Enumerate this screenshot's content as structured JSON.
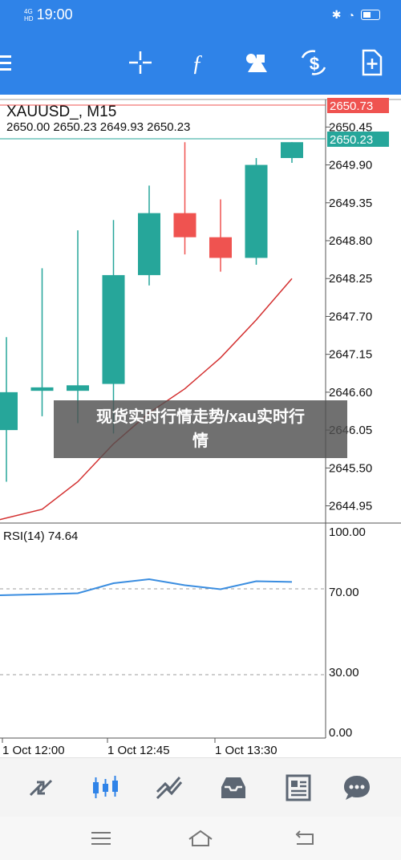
{
  "status_bar": {
    "network": "4G",
    "signal": "HD",
    "time": "19:00",
    "bluetooth_icon": "bluetooth-icon",
    "wifi_icon": "wifi-icon",
    "battery_icon": "battery-icon"
  },
  "toolbar": {
    "menu_icon": "menu-icon",
    "items": [
      {
        "name": "crosshair-icon"
      },
      {
        "name": "function-icon"
      },
      {
        "name": "objects-icon"
      },
      {
        "name": "currency-exchange-icon"
      },
      {
        "name": "new-order-icon"
      }
    ]
  },
  "chart": {
    "symbol_line": "XAUUSD_, M15",
    "ohlc_line": "2650.00 2650.23 2649.93 2650.23",
    "ask_label": "2650.73",
    "bid_label": "2650.23",
    "price_ticks": [
      "2650.45",
      "2649.90",
      "2649.35",
      "2648.80",
      "2648.25",
      "2647.70",
      "2647.15",
      "2646.60",
      "2646.05",
      "2645.50",
      "2644.95"
    ],
    "rsi_label": "RSI(14) 74.64",
    "rsi_ticks": [
      "100.00",
      "70.00",
      "30.00",
      "0.00"
    ],
    "time_labels": [
      "1 Oct 12:00",
      "1 Oct 12:45",
      "1 Oct 13:30"
    ],
    "colors": {
      "bull": "#26a69a",
      "bear": "#ef5350",
      "ma": "#d32f2f",
      "rsi": "#3a8de0",
      "ask_line": "#ef5350",
      "bid_line": "#26a69a"
    }
  },
  "chart_data": {
    "type": "candlestick",
    "symbol": "XAUUSD_",
    "timeframe": "M15",
    "ylim": [
      2644.7,
      2650.85
    ],
    "candles": [
      {
        "o": 2646.05,
        "h": 2647.4,
        "l": 2645.3,
        "c": 2646.6
      },
      {
        "o": 2646.62,
        "h": 2648.4,
        "l": 2646.25,
        "c": 2646.67
      },
      {
        "o": 2646.62,
        "h": 2648.95,
        "l": 2646.15,
        "c": 2646.7
      },
      {
        "o": 2646.72,
        "h": 2649.1,
        "l": 2646.0,
        "c": 2648.3
      },
      {
        "o": 2648.3,
        "h": 2649.6,
        "l": 2648.15,
        "c": 2649.2
      },
      {
        "o": 2649.2,
        "h": 2650.23,
        "l": 2648.6,
        "c": 2648.85
      },
      {
        "o": 2648.85,
        "h": 2649.4,
        "l": 2648.35,
        "c": 2648.55
      },
      {
        "o": 2648.55,
        "h": 2650.0,
        "l": 2648.45,
        "c": 2649.9
      },
      {
        "o": 2650.0,
        "h": 2650.23,
        "l": 2649.93,
        "c": 2650.23
      }
    ],
    "moving_average": [
      2644.75,
      2644.9,
      2645.3,
      2645.85,
      2646.3,
      2646.65,
      2647.1,
      2647.65,
      2648.25
    ],
    "rsi": {
      "name": "RSI(14)",
      "levels": [
        70,
        30
      ],
      "ylim": [
        0,
        100
      ],
      "values": [
        68,
        68.5,
        69,
        74,
        76,
        73,
        71,
        75,
        74.64
      ]
    }
  },
  "bottom_nav": [
    {
      "name": "quotes-nav-icon",
      "active": false
    },
    {
      "name": "chart-nav-icon",
      "active": true
    },
    {
      "name": "trade-nav-icon",
      "active": false
    },
    {
      "name": "history-nav-icon",
      "active": false
    },
    {
      "name": "news-nav-icon",
      "active": false
    },
    {
      "name": "messages-nav-icon",
      "active": false
    }
  ],
  "system_nav": {
    "menu": "system-menu-icon",
    "home": "system-home-icon",
    "back": "system-back-icon"
  },
  "overlay": {
    "line1": "现货实时行情走势/xau实时行",
    "line2": "情"
  }
}
